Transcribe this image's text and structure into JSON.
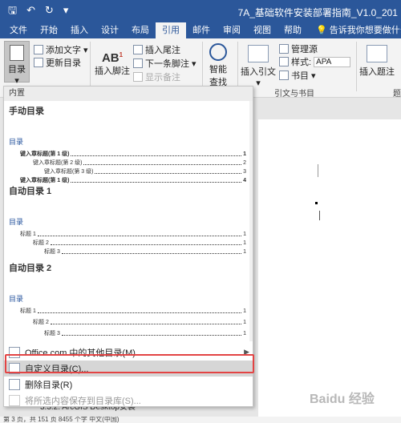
{
  "window": {
    "title": "7A_基础软件安装部署指南_V1.0_201",
    "qat": {
      "save": "🖫",
      "undo": "↶",
      "redo": "↻",
      "customize": "▾"
    }
  },
  "tabs": [
    "文件",
    "开始",
    "插入",
    "设计",
    "布局",
    "引用",
    "邮件",
    "审阅",
    "视图",
    "帮助"
  ],
  "tell_me": "告诉我你想要做什么",
  "ribbon": {
    "toc_button": "目录",
    "add_text": "添加文字",
    "update_toc": "更新目录",
    "insert_footnote": "插入脚注",
    "insert_endnote": "插入尾注",
    "next_footnote": "下一条脚注",
    "show_notes": "显示备注",
    "smart_lookup_1": "智能",
    "smart_lookup_2": "查找",
    "insert_citation": "插入引文",
    "manage_sources": "管理源",
    "style_label": "样式:",
    "style_value": "APA",
    "bibliography": "书目",
    "insert_caption": "插入题注",
    "group_citations": "引文与书目",
    "group_captions": "题"
  },
  "dropdown": {
    "header": "内置",
    "gallery": [
      {
        "title": "手动目录",
        "sub": "目录",
        "lines": [
          {
            "text": "键入章标题(第 1 级)",
            "page": "1",
            "level": 1
          },
          {
            "text": "键入章标题(第 2 级)",
            "page": "2",
            "level": 2
          },
          {
            "text": "键入章标题(第 3 级)",
            "page": "3",
            "level": 3
          },
          {
            "text": "键入章标题(第 1 级)",
            "page": "4",
            "level": 1
          }
        ]
      },
      {
        "title": "自动目录 1",
        "sub": "目录",
        "lines": [
          {
            "text": "标题 1",
            "page": "1",
            "level": 1
          },
          {
            "text": "标题 2",
            "page": "1",
            "level": 2
          },
          {
            "text": "标题 3",
            "page": "1",
            "level": 3
          }
        ]
      },
      {
        "title": "自动目录 2",
        "sub": "目录",
        "lines": [
          {
            "text": "标题 1",
            "page": "1",
            "level": 1
          },
          {
            "text": "标题 2",
            "page": "1",
            "level": 2
          },
          {
            "text": "标题 3",
            "page": "1",
            "level": 3
          }
        ]
      }
    ],
    "menu": {
      "more_toc": "Office.com 中的其他目录(M)",
      "custom_toc": "自定义目录(C)...",
      "remove_toc": "删除目录(R)",
      "save_selection": "将所选内容保存到目录库(S)..."
    }
  },
  "document": {
    "behind_text": "3.3.2. ArcGIS Desktop安装"
  },
  "statusbar": {
    "text": "第 3 页，共 151 页    8455 个字    中文(中国)"
  },
  "watermark": "Baidu 经验",
  "colors": {
    "accent": "#2b579a",
    "highlight_border": "#e34444"
  }
}
